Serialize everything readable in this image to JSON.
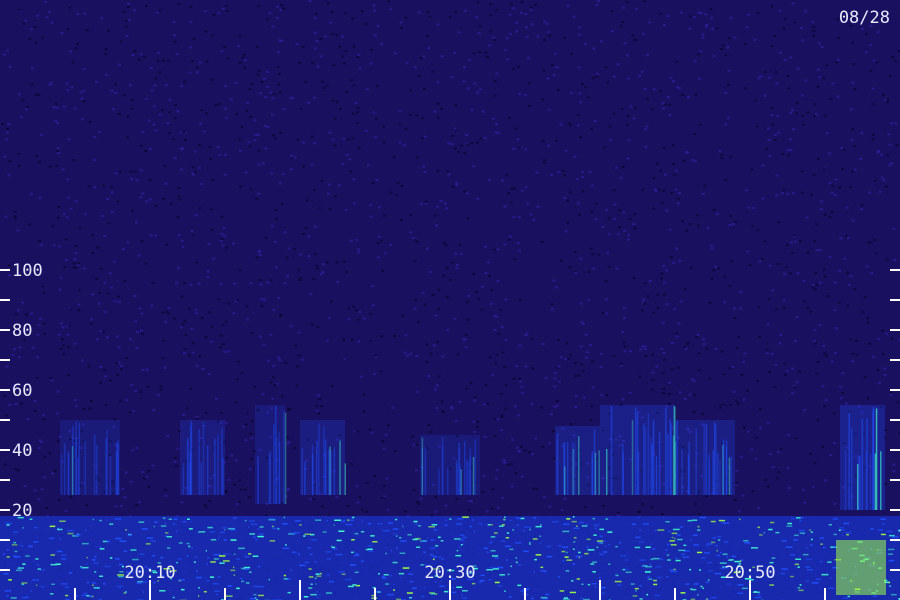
{
  "chart_data": {
    "type": "heatmap",
    "title": "",
    "date_label": "08/28",
    "xlabel": "",
    "ylabel": "",
    "x_tick_labels": [
      "20:10",
      "20:30",
      "20:50"
    ],
    "y_tick_labels": [
      "20",
      "40",
      "60",
      "80",
      "100"
    ],
    "ylim": [
      0,
      105
    ],
    "grid": false,
    "colors": {
      "background": "#1a1060",
      "low": "#2a1880",
      "mid": "#2050ff",
      "high": "#40ffd0",
      "peak": "#a0ff40",
      "axis": "#ffffff"
    },
    "activity_bands": [
      {
        "time_start": "20:04",
        "time_end": "20:08",
        "freq_low": 25,
        "freq_high": 50,
        "intensity": 0.25
      },
      {
        "time_start": "20:12",
        "time_end": "20:15",
        "freq_low": 25,
        "freq_high": 50,
        "intensity": 0.35
      },
      {
        "time_start": "20:17",
        "time_end": "20:19",
        "freq_low": 22,
        "freq_high": 55,
        "intensity": 0.3
      },
      {
        "time_start": "20:20",
        "time_end": "20:23",
        "freq_low": 25,
        "freq_high": 50,
        "intensity": 0.45
      },
      {
        "time_start": "20:28",
        "time_end": "20:32",
        "freq_low": 25,
        "freq_high": 45,
        "intensity": 0.25
      },
      {
        "time_start": "20:37",
        "time_end": "20:40",
        "freq_low": 25,
        "freq_high": 48,
        "intensity": 0.5
      },
      {
        "time_start": "20:40",
        "time_end": "20:45",
        "freq_low": 25,
        "freq_high": 55,
        "intensity": 0.6
      },
      {
        "time_start": "20:45",
        "time_end": "20:49",
        "freq_low": 25,
        "freq_high": 50,
        "intensity": 0.5
      },
      {
        "time_start": "20:56",
        "time_end": "20:59",
        "freq_low": 20,
        "freq_high": 55,
        "intensity": 0.75
      }
    ],
    "low_band": {
      "freq_low": 0,
      "freq_high": 18,
      "intensity": 0.85
    }
  }
}
